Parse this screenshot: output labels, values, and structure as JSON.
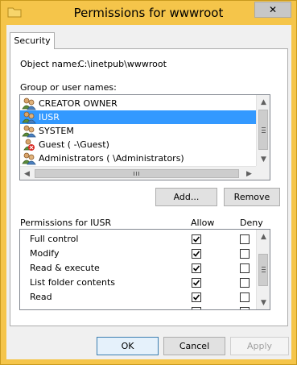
{
  "window": {
    "title": "Permissions for wwwroot",
    "close_glyph": "✕",
    "frame_color": "#f5c54a"
  },
  "tabs": [
    {
      "label": "Security"
    }
  ],
  "object": {
    "label": "Object name:",
    "value": "C:\\inetpub\\wwwroot"
  },
  "groups": {
    "label": "Group or user names:",
    "items": [
      {
        "name": "CREATOR OWNER",
        "icon": "users-group-icon",
        "selected": false
      },
      {
        "name": "IUSR",
        "icon": "users-group-icon",
        "selected": true
      },
      {
        "name": "SYSTEM",
        "icon": "users-group-icon",
        "selected": false
      },
      {
        "name": "Guest (              -\\Guest)",
        "icon": "user-disabled-icon",
        "selected": false
      },
      {
        "name": "Administrators (                     \\Administrators)",
        "icon": "users-group-icon",
        "selected": false
      }
    ],
    "selection_color": "#3399ff"
  },
  "buttons": {
    "add": "Add...",
    "remove": "Remove",
    "ok": "OK",
    "cancel": "Cancel",
    "apply": "Apply"
  },
  "permissions": {
    "header": "Permissions for IUSR",
    "allow_label": "Allow",
    "deny_label": "Deny",
    "rows": [
      {
        "name": "Full control",
        "allow": true,
        "deny": false
      },
      {
        "name": "Modify",
        "allow": true,
        "deny": false
      },
      {
        "name": "Read & execute",
        "allow": true,
        "deny": false
      },
      {
        "name": "List folder contents",
        "allow": true,
        "deny": false
      },
      {
        "name": "Read",
        "allow": true,
        "deny": false
      }
    ]
  }
}
